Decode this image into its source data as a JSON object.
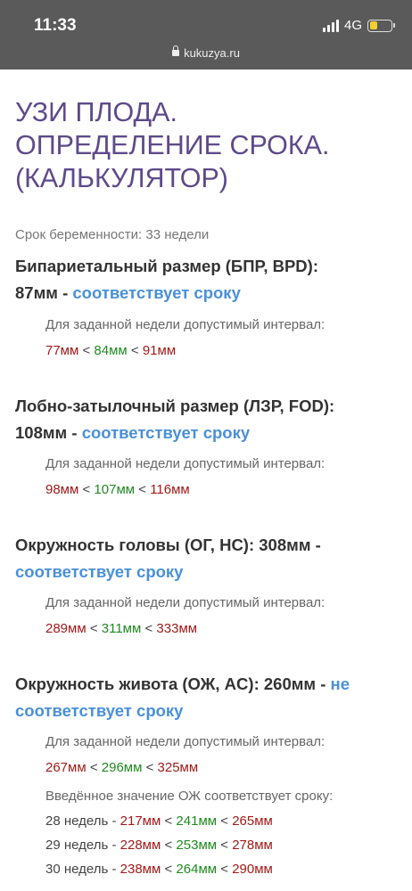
{
  "status": {
    "time": "11:33",
    "network": "4G",
    "url": "kukuzya.ru"
  },
  "page": {
    "title_lines": [
      "УЗИ ПЛОДА.",
      "ОПРЕДЕЛЕНИЕ СРОКА.",
      "(КАЛЬКУЛЯТОР)"
    ],
    "term": "Срок беременности: 33 недели",
    "interval_label": "Для заданной недели допустимый интервал:"
  },
  "params": [
    {
      "prefix": "Бипариетальный размер (БПР, BPD):",
      "value": "87мм - ",
      "verdict": "соответствует сроку",
      "min": "77мм",
      "mid": "84мм",
      "max": "91мм"
    },
    {
      "prefix": "Лобно-затылочный размер (ЛЗР, FOD):",
      "value": "108мм - ",
      "verdict": "соответствует сроку",
      "min": "98мм",
      "mid": "107мм",
      "max": "116мм"
    },
    {
      "prefix": "Окружность головы (ОГ, HC): 308мм -",
      "value": "",
      "verdict": "соответствует сроку",
      "min": "289мм",
      "mid": "311мм",
      "max": "333мм"
    },
    {
      "prefix": "Окружность живота (ОЖ, AC): 260мм - ",
      "value": "не",
      "verdict": "соответствует сроку",
      "min": "267мм",
      "mid": "296мм",
      "max": "325мм"
    }
  ],
  "ac_match": {
    "label": "Введённое значение ОЖ соответствует сроку:",
    "rows": [
      {
        "week": "28 недель - ",
        "min": "217мм",
        "mid": "241мм",
        "max": "265мм"
      },
      {
        "week": "29 недель - ",
        "min": "228мм",
        "mid": "253мм",
        "max": "278мм"
      },
      {
        "week": "30 недель - ",
        "min": "238мм",
        "mid": "264мм",
        "max": "290мм"
      }
    ]
  },
  "colors": {
    "title": "#5e4a8a",
    "ok": "#4a90d9",
    "min": "#a11a1a",
    "mid": "#1f8a1f"
  }
}
